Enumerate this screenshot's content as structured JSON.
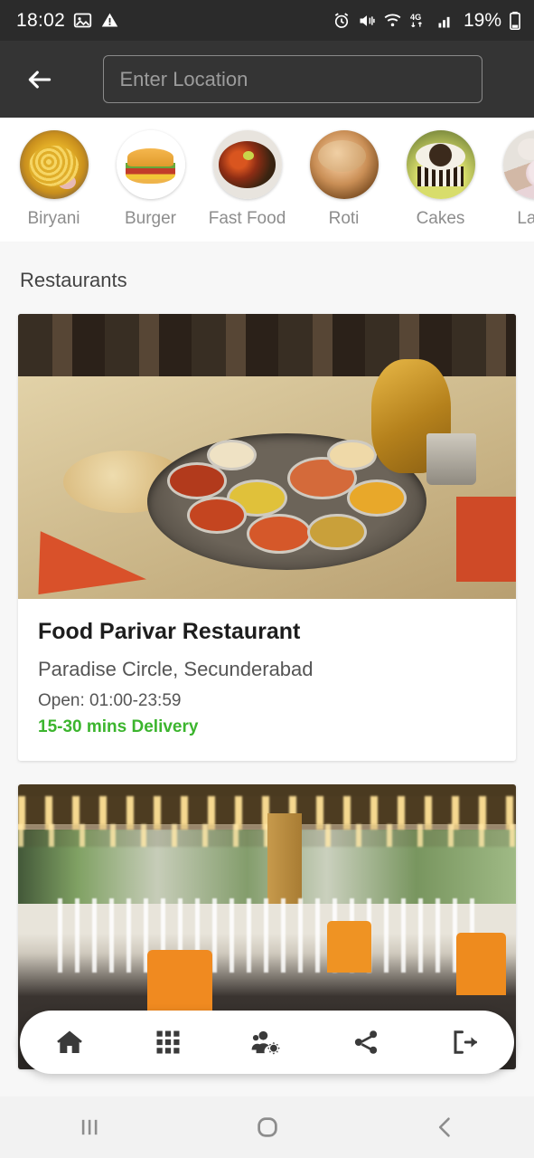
{
  "status_bar": {
    "time": "18:02",
    "battery_percent": "19%",
    "left_icons": [
      "image-icon",
      "warning-triangle-icon"
    ],
    "right_icons": [
      "alarm-icon",
      "mute-icon",
      "wifi-icon",
      "4g-icon",
      "signal-bars-icon",
      "battery-icon"
    ],
    "network_label": "4G",
    "background": "#2b2b2b"
  },
  "header": {
    "back_icon": "back-arrow-icon",
    "location_value": "",
    "location_placeholder": "Enter Location",
    "background": "#343434"
  },
  "categories": [
    {
      "label": "Biryani",
      "art": "biryani"
    },
    {
      "label": "Burger",
      "art": "burger"
    },
    {
      "label": "Fast Food",
      "art": "fastfood"
    },
    {
      "label": "Roti",
      "art": "roti"
    },
    {
      "label": "Cakes",
      "art": "cakes"
    },
    {
      "label": "Lassi",
      "art": "lassi"
    }
  ],
  "main": {
    "section_title": "Restaurants",
    "restaurants": [
      {
        "name": "Food Parivar Restaurant",
        "address": "Paradise Circle, Secunderabad",
        "hours": "Open: 01:00-23:59",
        "delivery": "15-30 mins Delivery",
        "delivery_color": "#3cb52e",
        "photo": "indian-thali-platter-with-brass-teapot"
      },
      {
        "name": "",
        "address": "",
        "hours": "",
        "delivery": "",
        "photo": "restaurant-interior-string-lights-orange-chairs"
      }
    ]
  },
  "bottom_nav": [
    {
      "icon": "home-icon",
      "label": "Home"
    },
    {
      "icon": "grid-apps-icon",
      "label": "Categories"
    },
    {
      "icon": "users-cog-icon",
      "label": "Manage Users"
    },
    {
      "icon": "share-icon",
      "label": "Share"
    },
    {
      "icon": "logout-icon",
      "label": "Logout"
    }
  ],
  "android_nav": [
    {
      "icon": "recents-icon"
    },
    {
      "icon": "home-circle-icon"
    },
    {
      "icon": "back-chevron-icon"
    }
  ]
}
